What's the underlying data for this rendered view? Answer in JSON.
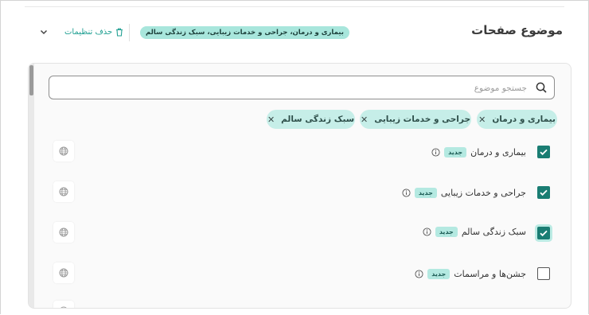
{
  "header": {
    "title": "موضوع صفحات",
    "summary_chip": "بیماری و درمان، جراحی و خدمات زیبایی، سبک زندگی سالم",
    "reset_label": "حذف تنظیمات"
  },
  "search": {
    "placeholder": "جستجو موضوع",
    "value": ""
  },
  "selected_chips": [
    {
      "label": "بیماری و درمان"
    },
    {
      "label": "جراحی و خدمات زیبایی"
    },
    {
      "label": "سبک زندگی سالم"
    }
  ],
  "topics": [
    {
      "label": "بیماری و درمان",
      "badge": "جدید",
      "checked": true
    },
    {
      "label": "جراحی و خدمات زیبایی",
      "badge": "جدید",
      "checked": true
    },
    {
      "label": "سبک زندگی سالم",
      "badge": "جدید",
      "checked": true,
      "focused": true
    },
    {
      "label": "جشن‌ها و مراسمات",
      "badge": "جدید",
      "checked": false
    }
  ],
  "colors": {
    "accent": "#1a7d73",
    "chip_bg": "#c6eee8",
    "badge_bg": "#b4e9e1",
    "link": "#22a093"
  }
}
